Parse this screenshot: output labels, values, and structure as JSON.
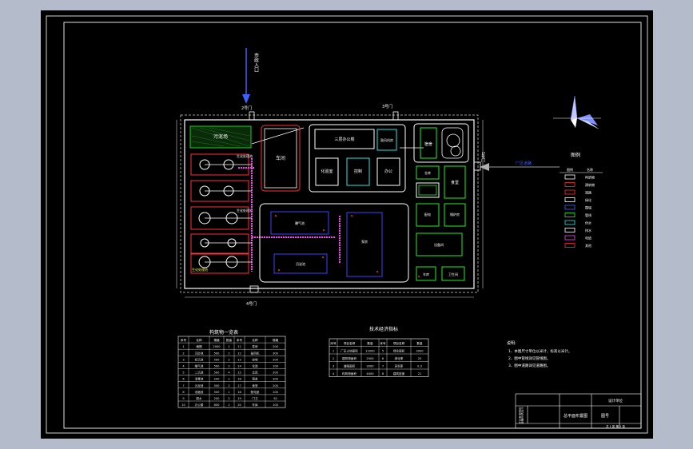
{
  "labels": {
    "entrance_top": "市政入口",
    "gate_2": "2号门",
    "gate_3": "3号门",
    "gate_1": "1号门",
    "gate_4": "4号门",
    "road_right": "厂区道路",
    "sludge_yard": "污泥场",
    "workshop": "车间",
    "aeration": "曝气池",
    "clarifier": "沉淀池",
    "pump_room": "泵房",
    "biochem_tank_a": "生化处理池",
    "biochem_tank_b": "生化处理池",
    "biochem_tank_c": "生化处理池",
    "main_building": "三层办公楼",
    "booster": "鼓风机房",
    "control": "控制",
    "lab": "化验室",
    "dormitory": "宿舍",
    "canteen": "食堂",
    "storage": "仓库",
    "parking": "停车场",
    "guard": "门卫",
    "garden": "花园",
    "power": "配电",
    "heating": "锅炉房",
    "equipment": "设备间",
    "water_treat": "给水处理",
    "office2": "办公",
    "garage": "车库",
    "sanitation": "卫生间",
    "north_arrow_label": "N"
  },
  "legend": {
    "title": "图例",
    "col_sym": "图例",
    "col_name": "名称",
    "rows": [
      "构筑物",
      "建筑物",
      "道路",
      "绿化",
      "围墙",
      "管线",
      "供水",
      "排水",
      "电缆",
      "其他"
    ]
  },
  "table1": {
    "title": "构筑物一览表",
    "headers": [
      "序号",
      "名称",
      "规格",
      "数量",
      "序号",
      "名称",
      "规格"
    ],
    "rows": [
      [
        "1",
        "格栅",
        "2000",
        "1",
        "11",
        "泵房",
        "200"
      ],
      [
        "2",
        "沉砂池",
        "500",
        "2",
        "12",
        "鼓风机",
        "300"
      ],
      [
        "3",
        "初沉池",
        "500",
        "2",
        "13",
        "控制",
        "200"
      ],
      [
        "4",
        "曝气池",
        "500",
        "2",
        "14",
        "化验",
        "100"
      ],
      [
        "5",
        "二沉池",
        "500",
        "4",
        "15",
        "仓库",
        "200"
      ],
      [
        "6",
        "消毒池",
        "200",
        "1",
        "16",
        "宿舍",
        "300"
      ],
      [
        "7",
        "污泥池",
        "500",
        "2",
        "17",
        "食堂",
        "200"
      ],
      [
        "8",
        "浓缩池",
        "500",
        "1",
        "18",
        "配电室",
        "100"
      ],
      [
        "9",
        "脱水",
        "200",
        "2",
        "19",
        "门卫",
        "50"
      ],
      [
        "10",
        "办公楼",
        "800",
        "1",
        "20",
        "车库",
        "100"
      ]
    ]
  },
  "table2": {
    "title": "技术经济指标",
    "headers": [
      "序号",
      "项目名称",
      "数量",
      "序号",
      "项目名称",
      "数量"
    ],
    "rows": [
      [
        "1",
        "厂区占地面积",
        "12000",
        "5",
        "绿化面积",
        "3000"
      ],
      [
        "2",
        "建筑物面积",
        "2500",
        "6",
        "绿化率",
        "25"
      ],
      [
        "3",
        "道路面积",
        "3000",
        "7",
        "容积率",
        "0.3"
      ],
      [
        "4",
        "构筑物面积",
        "4000",
        "8",
        "建筑密度",
        "21"
      ]
    ]
  },
  "notes": {
    "title": "说明:",
    "lines": [
      "1、本图尺寸单位以米计，标高以米计。",
      "2、图中管线详见管线图。",
      "3、图中道路详见道路图。"
    ]
  },
  "titleblock": {
    "project": "设计单位",
    "drawing_name": "总平面布置图",
    "drawing_no": "图号",
    "rows": [
      "设计",
      "校对",
      "审核",
      "审定",
      "日期",
      "比例"
    ],
    "bottom": "共 1 张  第 1 张"
  }
}
